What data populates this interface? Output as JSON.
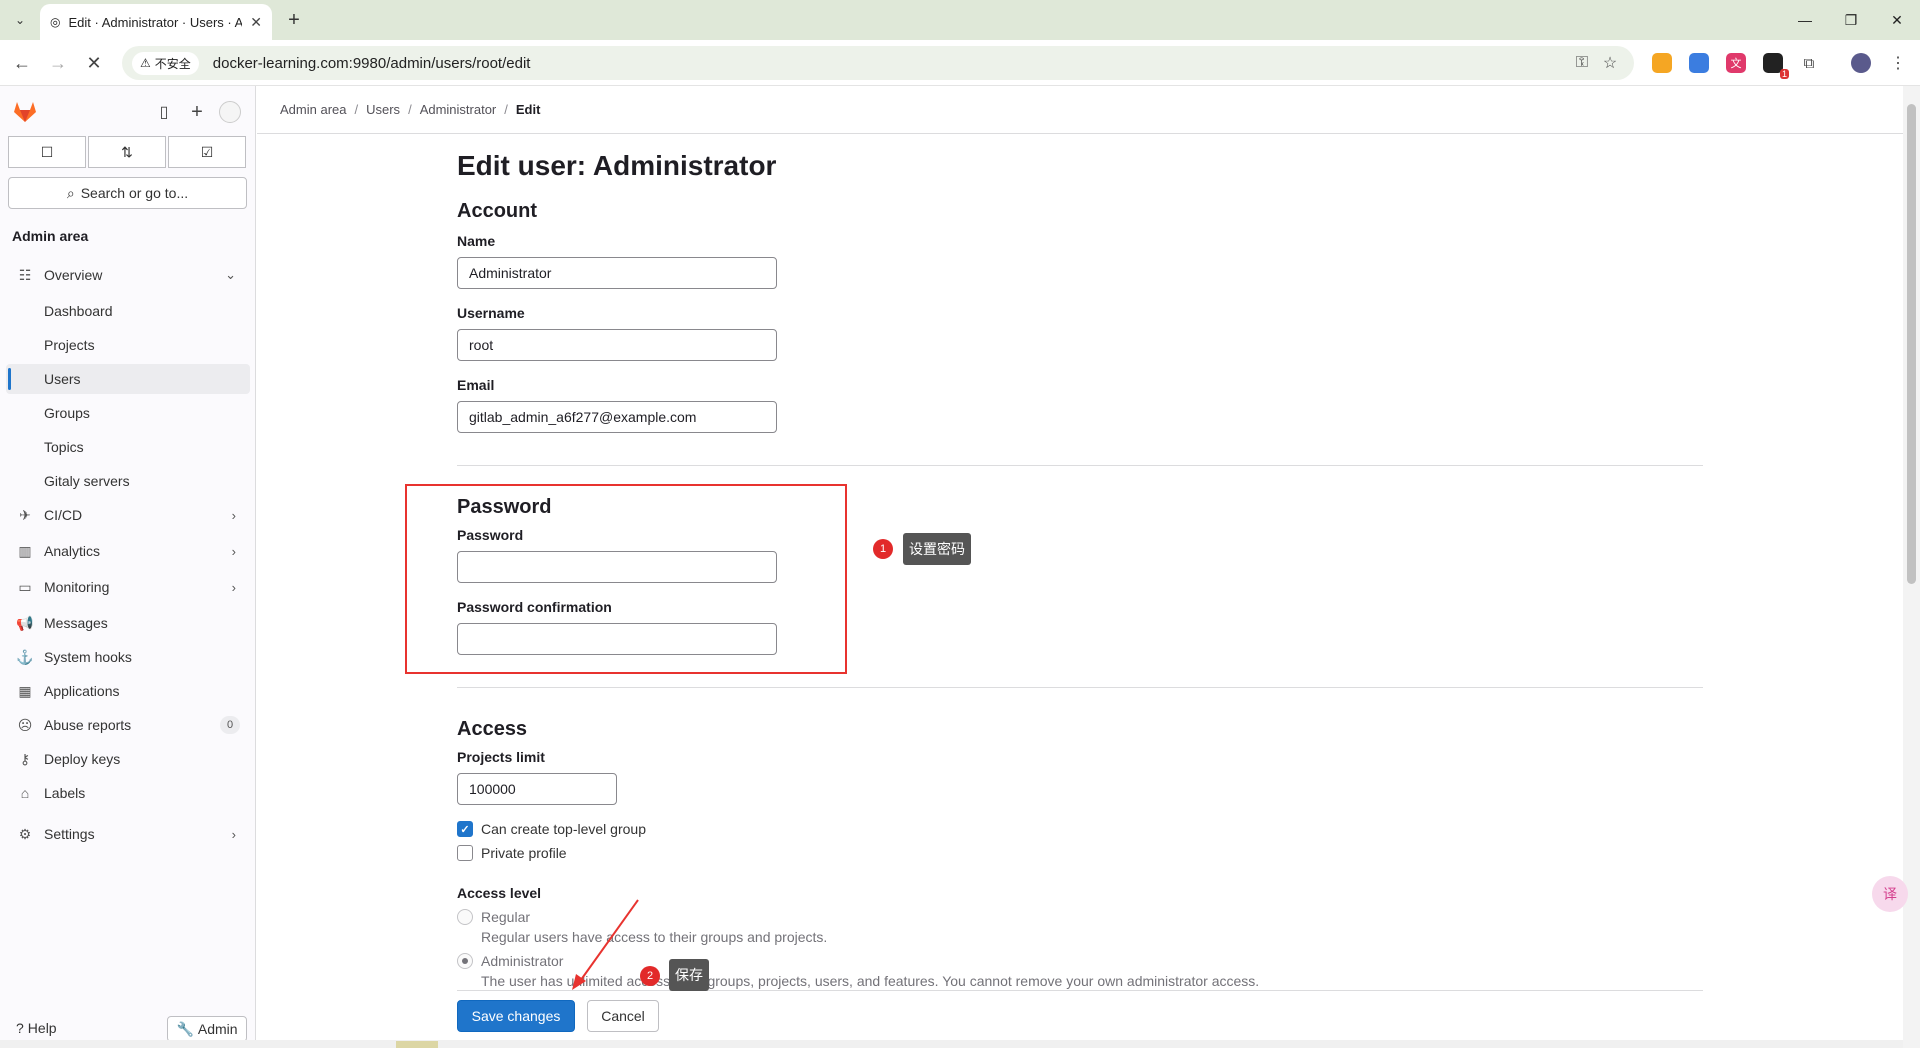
{
  "browser": {
    "tab_title": "Edit · Administrator · Users · A",
    "security_label": "不安全",
    "url": "docker-learning.com:9980/admin/users/root/edit",
    "ext_badge": "1"
  },
  "sidebar": {
    "search_label": "Search or go to...",
    "section_title": "Admin area",
    "overview_label": "Overview",
    "sub_items": [
      "Dashboard",
      "Projects",
      "Users",
      "Groups",
      "Topics",
      "Gitaly servers"
    ],
    "items": [
      "CI/CD",
      "Analytics",
      "Monitoring",
      "Messages",
      "System hooks",
      "Applications",
      "Abuse reports",
      "Deploy keys",
      "Labels",
      "Settings"
    ],
    "abuse_count": "0",
    "help_label": "Help",
    "admin_label": "Admin"
  },
  "breadcrumb": {
    "items": [
      "Admin area",
      "Users",
      "Administrator",
      "Edit"
    ]
  },
  "page": {
    "title": "Edit user: Administrator",
    "account": {
      "heading": "Account",
      "name_label": "Name",
      "name_value": "Administrator",
      "username_label": "Username",
      "username_value": "root",
      "email_label": "Email",
      "email_value": "gitlab_admin_a6f277@example.com"
    },
    "password": {
      "heading": "Password",
      "password_label": "Password",
      "confirmation_label": "Password confirmation"
    },
    "access": {
      "heading": "Access",
      "projects_limit_label": "Projects limit",
      "projects_limit_value": "100000",
      "can_create_group_label": "Can create top-level group",
      "can_create_group_checked": true,
      "private_profile_label": "Private profile",
      "private_profile_checked": false,
      "access_level_label": "Access level",
      "regular_label": "Regular",
      "regular_help": "Regular users have access to their groups and projects.",
      "admin_label": "Administrator",
      "admin_help": "The user has unlimited access to all groups, projects, users, and features. You cannot remove your own administrator access."
    },
    "save_label": "Save changes",
    "cancel_label": "Cancel"
  },
  "annotations": {
    "step1_num": "1",
    "step1_text": "设置密码",
    "step2_num": "2",
    "step2_text": "保存",
    "color": "#e8332f"
  },
  "translate_fab": "译"
}
